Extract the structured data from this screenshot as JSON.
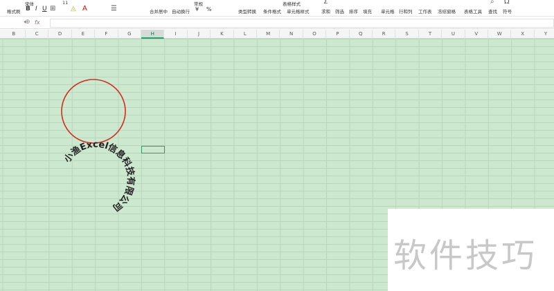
{
  "ribbon": {
    "font_name": "宋体",
    "font_size": "11",
    "number_format": "常规",
    "format_painter": "格式刷",
    "merge": "合并居中",
    "wrap": "自动换行",
    "type_convert": "类型转换",
    "cond_format": "条件格式",
    "table_style": "表格样式",
    "cell_style": "单元格样式",
    "sum": "求和",
    "filter": "筛选",
    "sort": "排序",
    "fill": "填充",
    "cell": "单元格",
    "row_col": "行和列",
    "worksheet": "工作表",
    "freeze": "冻结窗格",
    "table_tools": "表格工具",
    "find": "查找",
    "symbol": "符号",
    "bold": "B",
    "italic": "I",
    "underline": "U",
    "currency": "¥",
    "percent": "%"
  },
  "formula_bar": {
    "fx": "fx",
    "value": ""
  },
  "columns": [
    "B",
    "C",
    "D",
    "E",
    "F",
    "G",
    "H",
    "I",
    "J",
    "K",
    "L",
    "M",
    "N",
    "O",
    "P",
    "Q",
    "R",
    "S",
    "T",
    "U",
    "V",
    "W",
    "X",
    "Y"
  ],
  "selected_column": "H",
  "arc_text": "小渔Excel信息科技有限公司",
  "colors": {
    "circle": "#d62a1e",
    "grid_bg": "#cce8cf",
    "accent": "#21a366"
  },
  "watermark": "软件技巧"
}
